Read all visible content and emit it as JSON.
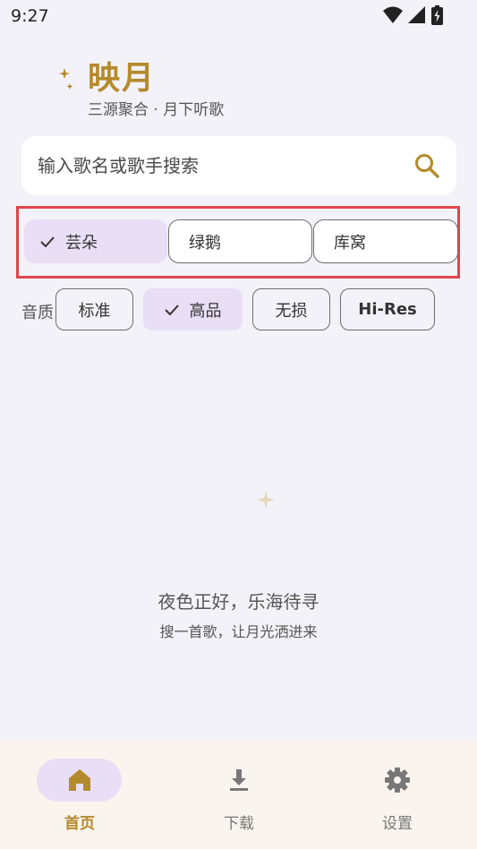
{
  "status_bar": {
    "time": "9:27"
  },
  "header": {
    "title": "映月",
    "subtitle": "三源聚合 · 月下听歌"
  },
  "search": {
    "placeholder": "输入歌名或歌手搜索"
  },
  "sources": [
    {
      "label": "芸朵",
      "selected": true
    },
    {
      "label": "绿鹅",
      "selected": false
    },
    {
      "label": "库窝",
      "selected": false
    }
  ],
  "quality": {
    "label": "音质",
    "options": [
      {
        "label": "标准",
        "selected": false
      },
      {
        "label": "高品",
        "selected": true
      },
      {
        "label": "无损",
        "selected": false
      },
      {
        "label": "Hi-Res",
        "selected": false
      }
    ]
  },
  "empty_state": {
    "title": "夜色正好，乐海待寻",
    "subtitle": "搜一首歌，让月光洒进来"
  },
  "bottom_nav": [
    {
      "label": "首页",
      "icon": "home-icon",
      "active": true
    },
    {
      "label": "下载",
      "icon": "download-icon",
      "active": false
    },
    {
      "label": "设置",
      "icon": "gear-icon",
      "active": false
    }
  ],
  "colors": {
    "accent": "#b58a2c",
    "selected_chip": "#e8def5",
    "background": "#f3f2f8",
    "highlight_border": "#e0454a",
    "nav_background": "#f9f4ee"
  }
}
